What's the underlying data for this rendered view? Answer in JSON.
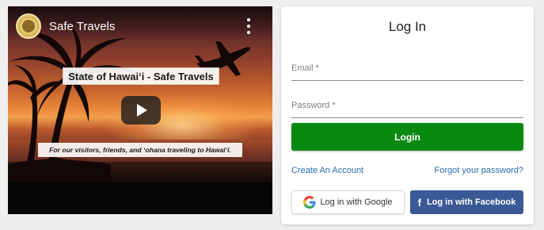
{
  "video": {
    "title": "Safe Travels",
    "banner": "State of Hawaiʻi - Safe Travels",
    "caption": "For our visitors, friends, and ʻohana traveling to Hawaiʻi.",
    "icons": {
      "logo": "state-seal-icon",
      "menu": "more-vert-icon",
      "play": "play-icon",
      "plane": "airplane-icon"
    }
  },
  "login": {
    "title": "Log In",
    "email_placeholder": "Email *",
    "password_placeholder": "Password *",
    "login_label": "Login",
    "create_account": "Create An Account",
    "forgot_password": "Forgot your password?",
    "google_label": "Log in with Google",
    "facebook_label": "Log in with Facebook",
    "colors": {
      "login_button": "#0b8a12",
      "link": "#2b6cb0",
      "facebook": "#3b5996"
    },
    "icons": {
      "google": "google-icon",
      "facebook": "facebook-icon"
    }
  }
}
